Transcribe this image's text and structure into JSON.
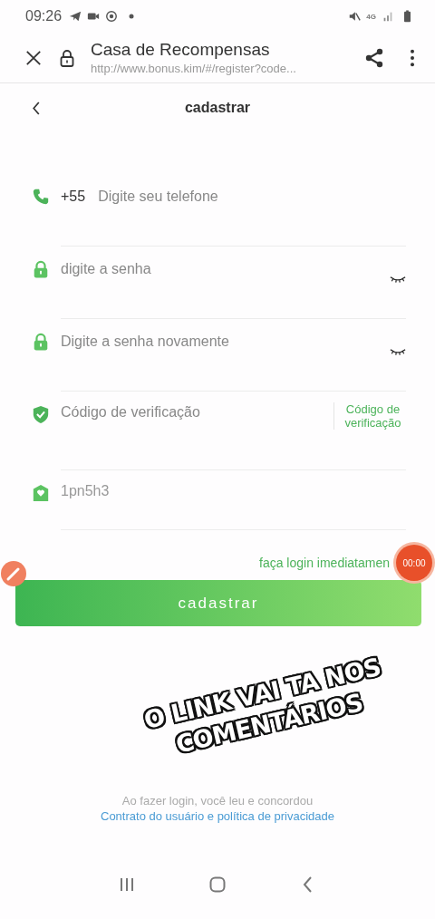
{
  "status_bar": {
    "time": "09:26",
    "network": "4G"
  },
  "browser": {
    "title": "Casa de Recompensas",
    "url": "http://www.bonus.kim/#/register?code..."
  },
  "header": {
    "title": "cadastrar"
  },
  "fields": [
    {
      "kind": "phone",
      "prefix": "+55",
      "placeholder": "Digite seu telefone"
    },
    {
      "kind": "password",
      "placeholder": "digite a senha"
    },
    {
      "kind": "password",
      "placeholder": "Digite a senha novamente"
    },
    {
      "kind": "code",
      "placeholder": "Código de verificação",
      "button": "Código de verificação"
    },
    {
      "kind": "captcha",
      "value": "1pn5h3"
    }
  ],
  "login_link": "faça login imediatamen",
  "timer": "00:00",
  "submit": "cadastrar",
  "caption": [
    "O LINK VAI TA NOS",
    "COMENTÁRIOS"
  ],
  "footer": {
    "note": "Ao fazer login, você leu e concordou",
    "link": "Contrato do usuário e política de privacidade"
  }
}
